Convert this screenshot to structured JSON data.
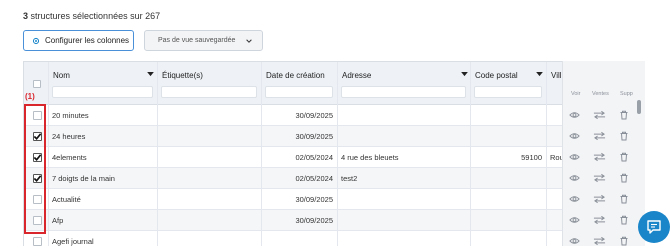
{
  "summary": {
    "count": "3",
    "text": "structures sélectionnées sur 267"
  },
  "toolbar": {
    "configure_label": "Configurer les colonnes",
    "view_select_value": "Pas de vue sauvegardée"
  },
  "table": {
    "headers": {
      "name": "Nom",
      "label": "Étiquette(s)",
      "created": "Date de création",
      "address": "Adresse",
      "postal": "Code postal",
      "city": "Vill"
    },
    "actions_headers": {
      "view": "Voir",
      "sales": "Ventes",
      "delete": "Supp"
    },
    "rows": [
      {
        "checked": false,
        "name": "20 minutes",
        "label": "",
        "created": "30/09/2025",
        "address": "",
        "postal": "",
        "city": ""
      },
      {
        "checked": true,
        "name": "24 heures",
        "label": "",
        "created": "30/09/2025",
        "address": "",
        "postal": "",
        "city": ""
      },
      {
        "checked": true,
        "name": "4elements",
        "label": "",
        "created": "02/05/2024",
        "address": "4 rue des bleuets",
        "postal": "59100",
        "city": "Rou"
      },
      {
        "checked": true,
        "name": "7 doigts de la main",
        "label": "",
        "created": "02/05/2024",
        "address": "test2",
        "postal": "",
        "city": ""
      },
      {
        "checked": false,
        "name": "Actualité",
        "label": "",
        "created": "30/09/2025",
        "address": "",
        "postal": "",
        "city": ""
      },
      {
        "checked": false,
        "name": "Afp",
        "label": "",
        "created": "30/09/2025",
        "address": "",
        "postal": "",
        "city": ""
      },
      {
        "checked": false,
        "name": "Agefi journal",
        "label": "",
        "created": "",
        "address": "",
        "postal": "",
        "city": ""
      }
    ]
  },
  "annotation": {
    "label": "(1)"
  },
  "colors": {
    "accent": "#1a86c9",
    "callout": "#d9262c"
  }
}
